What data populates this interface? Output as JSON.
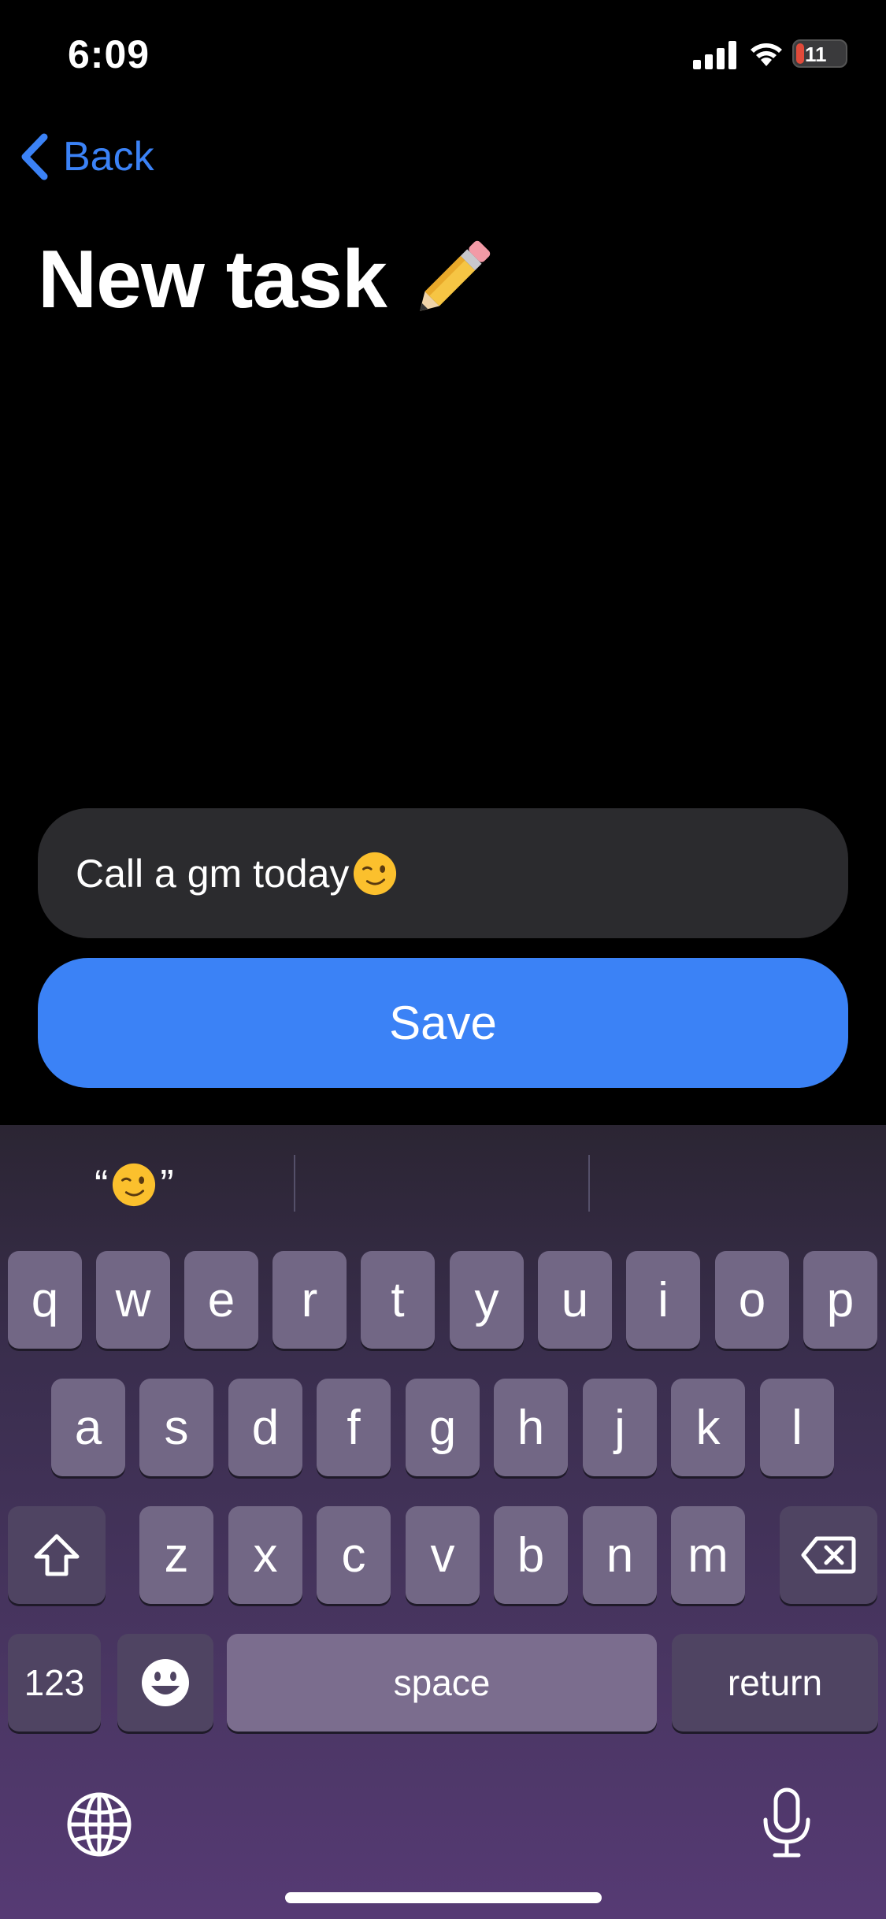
{
  "status_bar": {
    "time": "6:09",
    "battery_level": "11"
  },
  "nav": {
    "back_label": "Back"
  },
  "page": {
    "title": "New task",
    "title_emoji": "pencil"
  },
  "form": {
    "task_value": "Call a gm today",
    "task_emoji": "winking-face",
    "save_label": "Save"
  },
  "keyboard": {
    "suggestion_open_quote": "“",
    "suggestion_close_quote": "”",
    "row1": [
      "q",
      "w",
      "e",
      "r",
      "t",
      "y",
      "u",
      "i",
      "o",
      "p"
    ],
    "row2": [
      "a",
      "s",
      "d",
      "f",
      "g",
      "h",
      "j",
      "k",
      "l"
    ],
    "row3": [
      "z",
      "x",
      "c",
      "v",
      "b",
      "n",
      "m"
    ],
    "numbers_label": "123",
    "space_label": "space",
    "return_label": "return"
  },
  "colors": {
    "accent": "#3b82f6",
    "input_bg": "#2b2b2e",
    "background": "#000000"
  }
}
